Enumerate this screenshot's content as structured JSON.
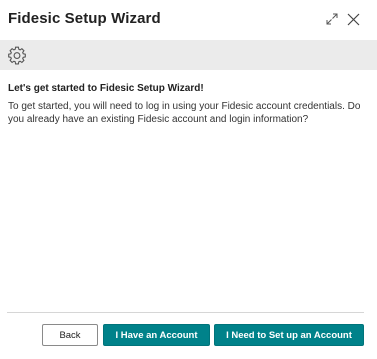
{
  "dialog": {
    "title": "Fidesic Setup Wizard",
    "expand_icon": "expand-icon",
    "close_icon": "close-icon"
  },
  "toolbar": {
    "settings_icon": "gear-icon"
  },
  "content": {
    "heading": "Let's get started to Fidesic Setup Wizard!",
    "body": "To get started, you will need to log in using your Fidesic account credentials. Do you already have an existing Fidesic account and login information?"
  },
  "footer": {
    "back_label": "Back",
    "have_account_label": "I Have an Account",
    "need_setup_label": "I Need to Set up an Account"
  },
  "colors": {
    "accent": "#00828a",
    "toolbar_bg": "#ebebeb"
  }
}
